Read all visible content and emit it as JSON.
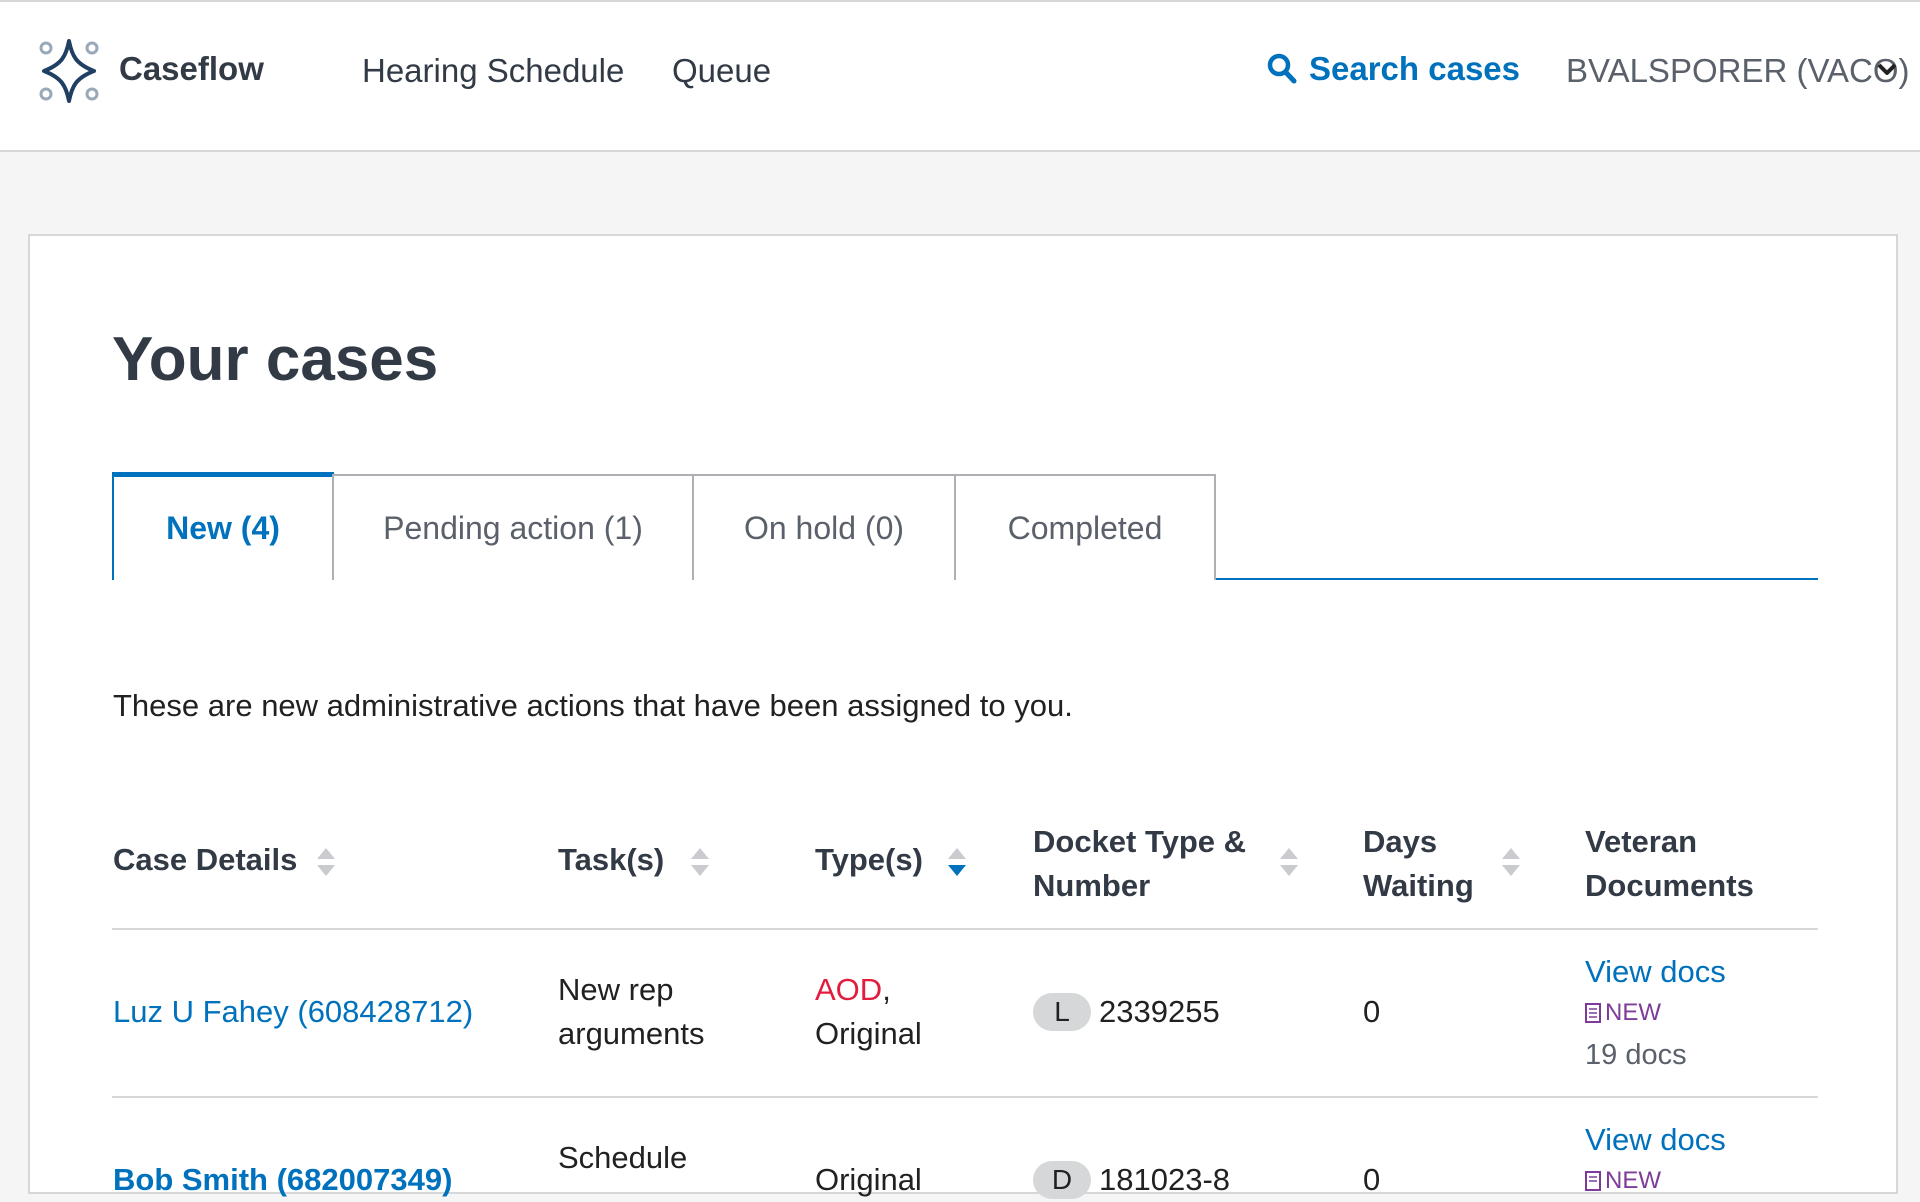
{
  "app": {
    "brand": "Caseflow",
    "nav": [
      "Hearing Schedule",
      "Queue"
    ],
    "search_label": "Search cases",
    "user": "BVALSPORER (VACO)"
  },
  "page": {
    "title": "Your cases",
    "tabs": [
      {
        "label": "New (4)",
        "active": true
      },
      {
        "label": "Pending action (1)",
        "active": false
      },
      {
        "label": "On hold (0)",
        "active": false
      },
      {
        "label": "Completed",
        "active": false
      }
    ],
    "description": "These are new administrative actions that have been assigned to you."
  },
  "table": {
    "headers": {
      "case_details": "Case Details",
      "tasks": "Task(s)",
      "types": "Type(s)",
      "docket_1": "Docket Type &",
      "docket_2": "Number",
      "days_1": "Days",
      "days_2": "Waiting",
      "docs_1": "Veteran",
      "docs_2": "Documents"
    },
    "rows": [
      {
        "case": "Luz U Fahey (608428712)",
        "task_1": "New rep",
        "task_2": "arguments",
        "type_aod": "AOD",
        "type_sep": ",",
        "type_2": "Original",
        "docket_type": "L",
        "docket_number": "2339255",
        "days": "0",
        "view_docs": "View docs",
        "new_label": "NEW",
        "doc_count": "19 docs"
      },
      {
        "case": "Bob Smith (682007349)",
        "task_1": "Schedule",
        "type_2": "Original",
        "docket_type": "D",
        "docket_number": "181023-8",
        "days": "0",
        "view_docs": "View docs",
        "new_label": "NEW"
      }
    ]
  },
  "colors": {
    "accent": "#0071bc",
    "aod": "#e31c3d",
    "new_badge": "#7e3c9a"
  }
}
